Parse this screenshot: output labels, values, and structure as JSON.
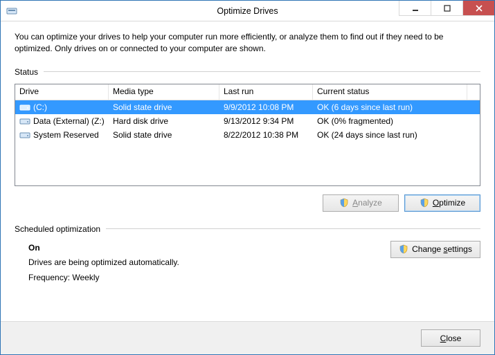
{
  "window": {
    "title": "Optimize Drives"
  },
  "description": "You can optimize your drives to help your computer run more efficiently, or analyze them to find out if they need to be optimized. Only drives on or connected to your computer are shown.",
  "status_label": "Status",
  "columns": {
    "drive": "Drive",
    "media": "Media type",
    "last": "Last run",
    "status": "Current status"
  },
  "drives": [
    {
      "name": "(C:)",
      "media": "Solid state drive",
      "last": "9/9/2012 10:08 PM",
      "status": "OK (6 days since last run)",
      "selected": true
    },
    {
      "name": "Data (External) (Z:)",
      "media": "Hard disk drive",
      "last": "9/13/2012 9:34 PM",
      "status": "OK (0% fragmented)",
      "selected": false
    },
    {
      "name": "System Reserved",
      "media": "Solid state drive",
      "last": "8/22/2012 10:38 PM",
      "status": "OK (24 days since last run)",
      "selected": false
    }
  ],
  "buttons": {
    "analyze_pre": "",
    "analyze_u": "A",
    "analyze_post": "nalyze",
    "optimize_pre": "",
    "optimize_u": "O",
    "optimize_post": "ptimize",
    "change_pre": "Change ",
    "change_u": "s",
    "change_post": "ettings",
    "close_pre": "",
    "close_u": "C",
    "close_post": "lose"
  },
  "scheduled": {
    "header": "Scheduled optimization",
    "state": "On",
    "line1": "Drives are being optimized automatically.",
    "line2": "Frequency: Weekly"
  }
}
